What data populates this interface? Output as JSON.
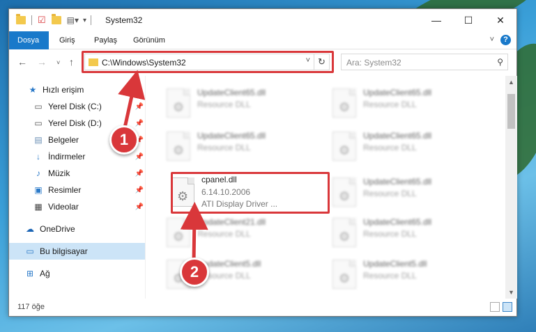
{
  "window": {
    "title": "System32",
    "minimize_icon": "minimize-icon",
    "maximize_icon": "maximize-icon",
    "close_icon": "close-icon"
  },
  "ribbon": {
    "tabs": [
      "Dosya",
      "Giriş",
      "Paylaş",
      "Görünüm"
    ],
    "active_tab": "Dosya"
  },
  "address": {
    "path": "C:\\Windows\\System32",
    "search_placeholder": "Ara: System32"
  },
  "sidebar": {
    "items": [
      {
        "label": "Hızlı erişim",
        "icon": "star-icon",
        "pinned": false
      },
      {
        "label": "Yerel Disk (C:)",
        "icon": "drive-icon",
        "pinned": true
      },
      {
        "label": "Yerel Disk (D:)",
        "icon": "drive-icon",
        "pinned": true
      },
      {
        "label": "Belgeler",
        "icon": "documents-icon",
        "pinned": true
      },
      {
        "label": "İndirmeler",
        "icon": "download-icon",
        "pinned": true
      },
      {
        "label": "Müzik",
        "icon": "music-icon",
        "pinned": true
      },
      {
        "label": "Resimler",
        "icon": "pictures-icon",
        "pinned": true
      },
      {
        "label": "Videolar",
        "icon": "videos-icon",
        "pinned": true
      },
      {
        "label": "OneDrive",
        "icon": "cloud-icon",
        "pinned": false
      },
      {
        "label": "Bu bilgisayar",
        "icon": "computer-icon",
        "pinned": false,
        "selected": true
      },
      {
        "label": "Ağ",
        "icon": "network-icon",
        "pinned": false
      }
    ]
  },
  "files": [
    {
      "name": "UpdateClient65.dll",
      "line1": "Resource DLL",
      "line2": ""
    },
    {
      "name": "UpdateClient65.dll",
      "line1": "Resource DLL",
      "line2": ""
    },
    {
      "name": "UpdateClient65.dll",
      "line1": "Resource DLL",
      "line2": ""
    },
    {
      "name": "UpdateClient65.dll",
      "line1": "Resource DLL",
      "line2": ""
    },
    {
      "name": "cpanel.dll",
      "line1": "6.14.10.2006",
      "line2": "ATI Display Driver ...",
      "highlighted": true
    },
    {
      "name": "UpdateClient65.dll",
      "line1": "Resource DLL",
      "line2": ""
    },
    {
      "name": "UpdateClient21.dll",
      "line1": "Resource DLL",
      "line2": ""
    },
    {
      "name": "UpdateClient65.dll",
      "line1": "Resource DLL",
      "line2": ""
    },
    {
      "name": "UpdateClient5.dll",
      "line1": "Resource DLL",
      "line2": ""
    },
    {
      "name": "UpdateClient5.dll",
      "line1": "Resource DLL",
      "line2": ""
    }
  ],
  "status": {
    "item_count": "117 öğe"
  },
  "annotations": {
    "marker_1": "1",
    "marker_2": "2",
    "accent_color": "#d9373a"
  }
}
